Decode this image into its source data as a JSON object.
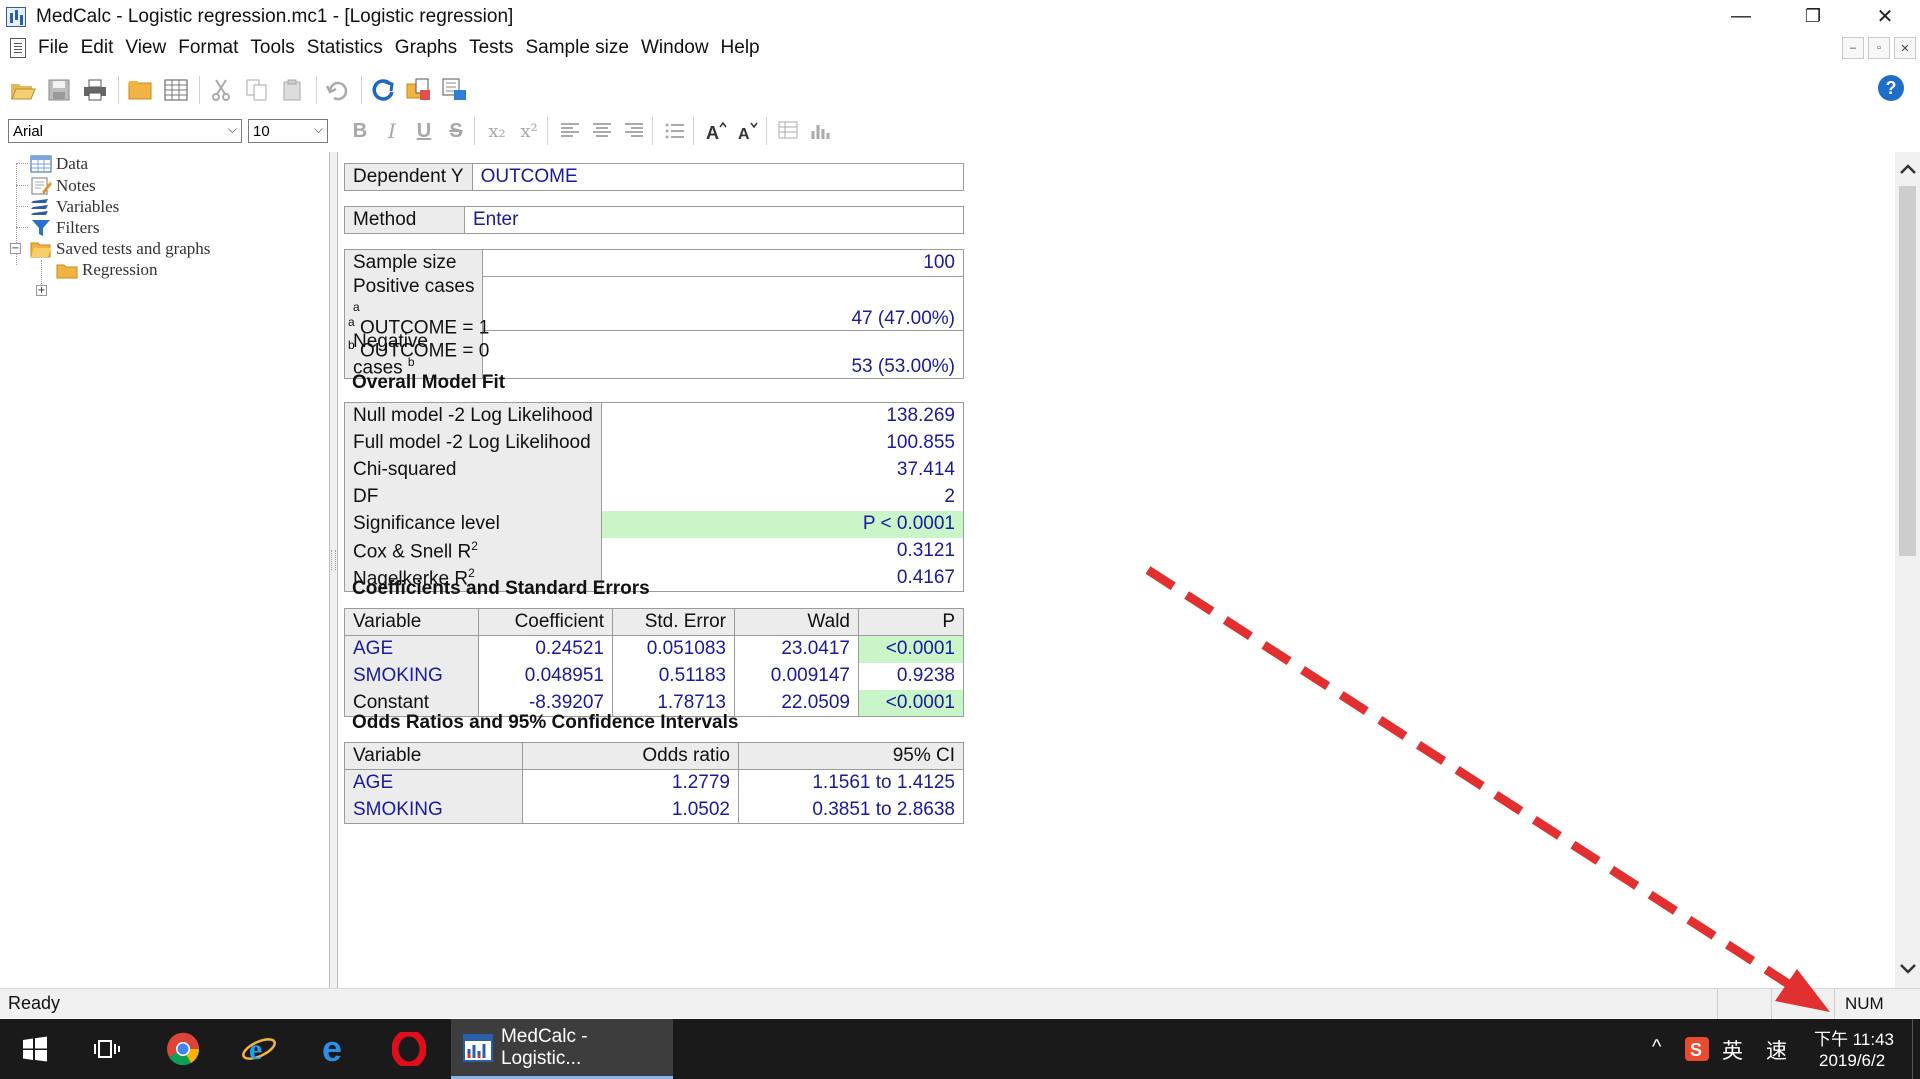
{
  "window": {
    "title": "MedCalc - Logistic regression.mc1 - [Logistic regression]",
    "minimize": "—",
    "restore": "❐",
    "close": "✕"
  },
  "menu": [
    "File",
    "Edit",
    "View",
    "Format",
    "Tools",
    "Statistics",
    "Graphs",
    "Tests",
    "Sample size",
    "Window",
    "Help"
  ],
  "mdi_controls": [
    "–",
    "▫",
    "✕"
  ],
  "toolbar": {
    "icons": [
      "open-folder-icon",
      "save-icon",
      "print-icon",
      "folder-icon",
      "spreadsheet-icon",
      "cut-icon",
      "copy-icon",
      "paste-icon",
      "undo-icon",
      "refresh-icon",
      "export-icon",
      "export-text-icon"
    ],
    "help": "?"
  },
  "format_bar": {
    "font": "Arial",
    "size": "10",
    "buttons": [
      "B",
      "I",
      "U",
      "S",
      "x₂",
      "x²"
    ]
  },
  "tree": {
    "items": [
      {
        "label": "Data"
      },
      {
        "label": "Notes"
      },
      {
        "label": "Variables"
      },
      {
        "label": "Filters"
      },
      {
        "label": "Saved tests and graphs"
      },
      {
        "label": "Regression"
      }
    ]
  },
  "report": {
    "dependent": {
      "label": "Dependent Y",
      "value": "OUTCOME"
    },
    "method": {
      "label": "Method",
      "value": "Enter"
    },
    "sample": {
      "size_label": "Sample size",
      "size_value": "100",
      "pos_label": "Positive cases",
      "pos_sup": "a",
      "pos_value": "47 (47.00%)",
      "neg_label_1": "Negative",
      "neg_label_2": "cases",
      "neg_sup": "b",
      "neg_value": "53 (53.00%)"
    },
    "footnotes": [
      {
        "sup": "a",
        "text": " OUTCOME = 1"
      },
      {
        "sup": "b",
        "text": " OUTCOME = 0"
      }
    ],
    "fit": {
      "title": "Overall Model Fit",
      "rows": [
        {
          "label": "Null model -2 Log Likelihood",
          "value": "138.269"
        },
        {
          "label": "Full model -2 Log Likelihood",
          "value": "100.855"
        },
        {
          "label": "Chi-squared",
          "value": "37.414"
        },
        {
          "label": "DF",
          "value": "2"
        },
        {
          "label": "Significance level",
          "value": "P < 0.0001"
        },
        {
          "label": "Cox & Snell R",
          "sup": "2",
          "value": "0.3121"
        },
        {
          "label": "Nagelkerke R",
          "sup": "2",
          "value": "0.4167"
        }
      ]
    },
    "coef": {
      "title": "Coefficients and Standard Errors",
      "headers": [
        "Variable",
        "Coefficient",
        "Std. Error",
        "Wald",
        "P"
      ],
      "rows": [
        [
          "AGE",
          "0.24521",
          "0.051083",
          "23.0417",
          "<0.0001"
        ],
        [
          "SMOKING",
          "0.048951",
          "0.51183",
          "0.009147",
          "0.9238"
        ],
        [
          "Constant",
          "-8.39207",
          "1.78713",
          "22.0509",
          "<0.0001"
        ]
      ]
    },
    "odds": {
      "title": "Odds Ratios and 95% Confidence Intervals",
      "headers": [
        "Variable",
        "Odds ratio",
        "95% CI"
      ],
      "rows": [
        [
          "AGE",
          "1.2779",
          "1.1561 to 1.4125"
        ],
        [
          "SMOKING",
          "1.0502",
          "0.3851 to 2.8638"
        ]
      ]
    }
  },
  "status": {
    "left": "Ready",
    "num": "NUM"
  },
  "taskbar": {
    "active_app": "MedCalc - Logistic...",
    "time": "下午 11:43",
    "date": "2019/6/2",
    "ime_lang": "英",
    "ime_mode": "速",
    "tray_chevron": "^"
  },
  "colors": {
    "value_text": "#1a1a9e",
    "label_bg": "#ececec",
    "significant_bg": "#c9f5c9",
    "annotation_arrow": "#e23030"
  }
}
